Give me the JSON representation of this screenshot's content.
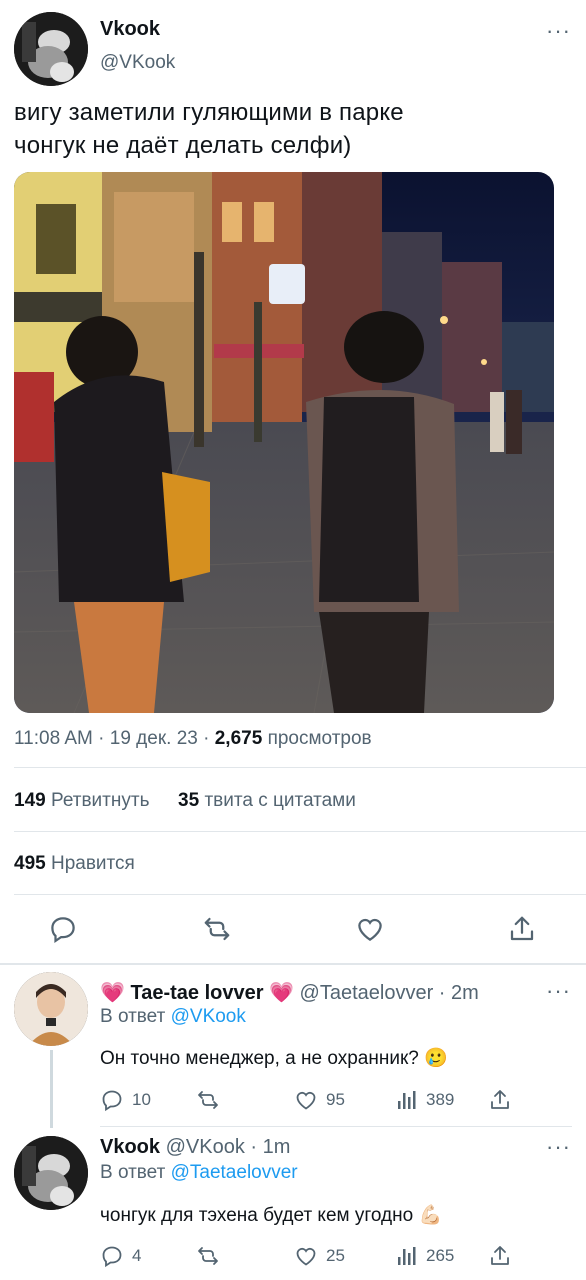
{
  "main_tweet": {
    "display_name": "Vkook",
    "handle": "@VKook",
    "text_line1": "вигу заметили гуляющими в парке",
    "text_line2": "чонгук не даёт делать селфи)",
    "time": "11:08 AM",
    "date": "19 дек. 23",
    "views_count": "2,675",
    "views_label": "просмотров",
    "retweets_count": "149",
    "retweets_label": "Ретвитнуть",
    "quotes_count": "35",
    "quotes_label": "твита с цитатами",
    "likes_count": "495",
    "likes_label": "Нравится",
    "actions": [
      "reply-icon",
      "retweet-icon",
      "like-icon",
      "share-icon"
    ]
  },
  "replies": [
    {
      "display_name": "Tae-tae lovver",
      "name_emoji": "💗",
      "handle": "@Taetaelovver",
      "time": "2m",
      "reply_to_label": "В ответ",
      "reply_to_handle": "@VKook",
      "text": "Он точно менеджер, а не охранник? 🥲",
      "reply_count": "10",
      "like_count": "95",
      "views_count": "389"
    },
    {
      "display_name": "Vkook",
      "handle": "@VKook",
      "time": "1m",
      "reply_to_label": "В ответ",
      "reply_to_handle": "@Taetaelovver",
      "text": "чонгук для тэхена будет кем угодно 💪🏻",
      "reply_count": "4",
      "like_count": "25",
      "views_count": "265"
    }
  ],
  "colors": {
    "text": "#0f1419",
    "secondary": "#536471",
    "link": "#1d9bf0",
    "divider": "#e1e6ea"
  }
}
